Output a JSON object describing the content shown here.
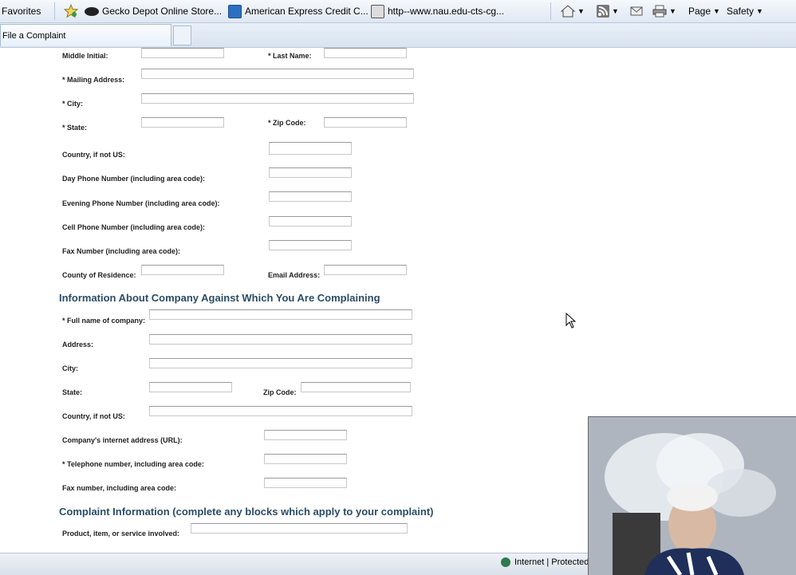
{
  "favbar": {
    "favorites_label": "Favorites",
    "links": [
      "Gecko Depot Online Store...",
      "American Express Credit C...",
      "http--www.nau.edu-cts-cg..."
    ],
    "page_menu": "Page",
    "safety_menu": "Safety"
  },
  "tab": {
    "title": "File a Complaint"
  },
  "form": {
    "personal": {
      "middle_initial": "Middle Initial:",
      "last_name": "* Last Name:",
      "mailing_address": "* Mailing Address:",
      "city": "* City:",
      "state": "* State:",
      "zip": "* Zip Code:",
      "country": "Country, if not US:",
      "day_phone": "Day Phone Number (including area code):",
      "evening_phone": "Evening Phone Number (including area code):",
      "cell_phone": "Cell Phone Number (including area code):",
      "fax": "Fax Number (including area code):",
      "county": "County of Residence:",
      "email": "Email Address:"
    },
    "company_heading": "Information About Company Against Which You Are Complaining",
    "company": {
      "full_name": "* Full name of company:",
      "address": "Address:",
      "city": "City:",
      "state": "State:",
      "zip": "Zip Code:",
      "country": "Country, if not US:",
      "url": "Company's internet address (URL):",
      "phone": "* Telephone number, including area code:",
      "fax": "Fax number, including area code:"
    },
    "complaint_heading": "Complaint Information (complete any blocks which apply to your complaint)",
    "complaint": {
      "product": "Product, item, or service involved:"
    }
  },
  "status": {
    "zone": "Internet | Protected"
  }
}
